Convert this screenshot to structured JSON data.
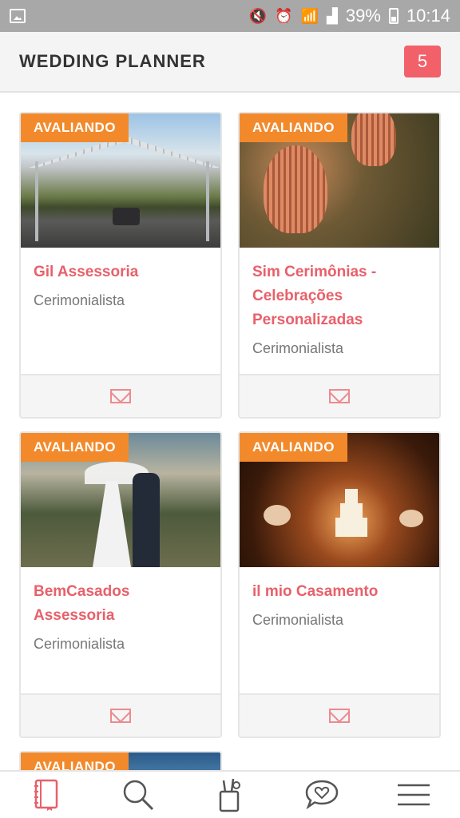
{
  "status_bar": {
    "battery": "39%",
    "time": "10:14"
  },
  "header": {
    "title": "WEDDING PLANNER",
    "badge_count": "5"
  },
  "cards": [
    {
      "tag": "AVALIANDO",
      "name": "Gil Assessoria",
      "category": "Cerimonialista"
    },
    {
      "tag": "AVALIANDO",
      "name": "Sim Cerimônias - Celebrações Personalizadas",
      "category": "Cerimonialista"
    },
    {
      "tag": "AVALIANDO",
      "name": "BemCasados Assessoria",
      "category": "Cerimonialista"
    },
    {
      "tag": "AVALIANDO",
      "name": "il mio Casamento",
      "category": "Cerimonialista"
    },
    {
      "tag": "AVALIANDO"
    }
  ],
  "bottom_nav": [
    {
      "icon": "notebook-icon"
    },
    {
      "icon": "search-icon"
    },
    {
      "icon": "tools-icon"
    },
    {
      "icon": "heart-chat-icon"
    },
    {
      "icon": "hamburger-menu-icon"
    }
  ],
  "colors": {
    "accent": "#e8606a",
    "tag": "#f28a2c",
    "badge": "#f2606a"
  }
}
